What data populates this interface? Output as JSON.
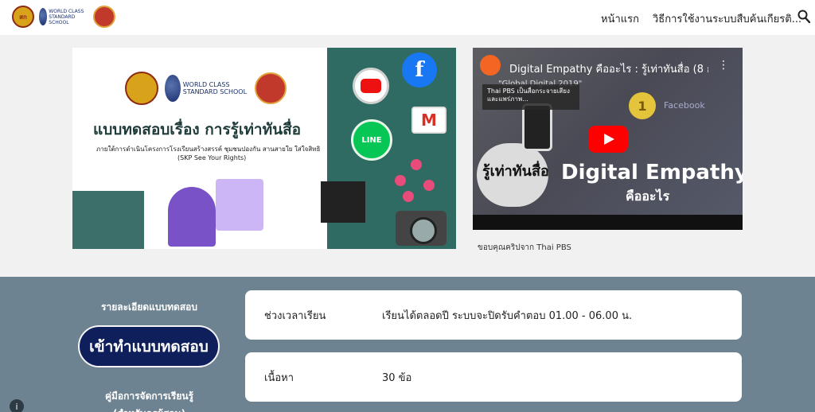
{
  "header": {
    "nav_home": "หน้าแรก",
    "nav_howto": "วิธีการใช้งานระบบสืบค้นเกียรติ...",
    "logo_wc_text": "WORLD CLASS STANDARD SCHOOL",
    "logo_short": "สก"
  },
  "banner": {
    "title": "แบบทดสอบเรื่อง การรู้เท่าทันสื่อ",
    "subtitle_line1": "ภายใต้การดำเนินโครงการโรงเรียนสร้างสรรค์ ชุมชนปองกัน สานสายใย ใส่ใจสิทธิ",
    "subtitle_line2": "(SKP See Your Rights)",
    "wc_text": "WORLD CLASS STANDARD SCHOOL",
    "line_label": "LINE",
    "fb_label": "f",
    "gmail_label": "M"
  },
  "video": {
    "title": "Digital Empathy คืออะไร : รู้เท่าทันสื่อ (8 ก....",
    "menu_glyph": "⋮",
    "tooltip": "Thai PBS เป็นสื่อกระจายเสียงและแพร่ภาพ...",
    "year_text": "\"Global Digital 2019\"",
    "headline": "Digital Empathy",
    "sub_headline": "คืออะไร",
    "cloud_text": "รู้เท่าทันสื่อ",
    "medal": "1",
    "fb_text": "Facebook",
    "caption": "ขอบคุณคริปจาก Thai PBS"
  },
  "lower": {
    "details_label": "รายละเอียดแบบทดสอบ",
    "enter_button": "เข้าทำแบบทดสอบ",
    "manual_label_line1": "คู่มือการจัดการเรียนรู้",
    "manual_label_line2": "(สำหรับครูผู้สอน)",
    "cards": [
      {
        "key": "ช่วงเวลาเรียน",
        "value": "เรียนได้ตลอดปี ระบบจะปิดรับคำตอบ 01.00 - 06.00 น."
      },
      {
        "key": "เนื้อหา",
        "value": "30 ข้อ"
      }
    ],
    "info_glyph": "i"
  }
}
